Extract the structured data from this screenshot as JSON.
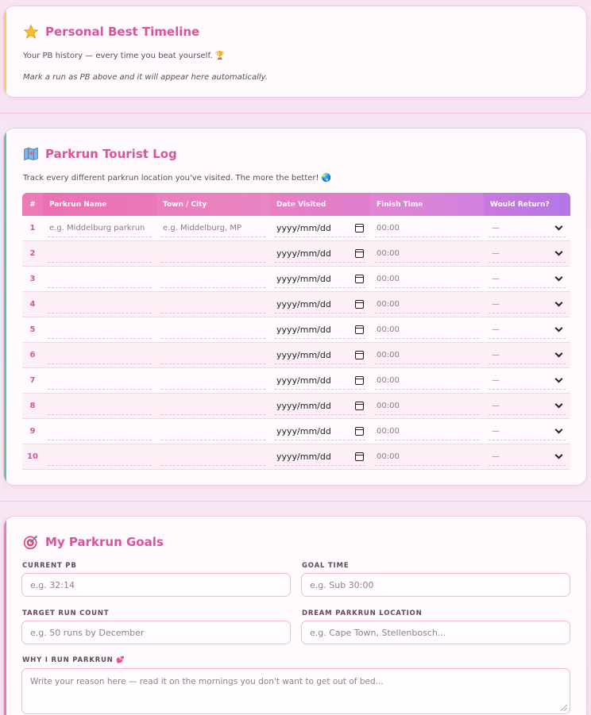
{
  "pb_timeline": {
    "title": "Personal Best Timeline",
    "icon": "star-icon",
    "description": "Your PB history — every time you beat yourself. 🏆",
    "empty_message": "Mark a run as PB above and it will appear here automatically."
  },
  "tourist_log": {
    "title": "Parkrun Tourist Log",
    "icon": "map-icon",
    "description": "Track every different parkrun location you've visited. The more the better! 🌏",
    "columns": [
      "#",
      "Parkrun Name",
      "Town / City",
      "Date Visited",
      "Finish Time",
      "Would Return?"
    ],
    "rows": [
      {
        "num": "1",
        "name_placeholder": "e.g. Middelburg parkrun",
        "town_placeholder": "e.g. Middelburg, MP",
        "date": "yyyy/mm/dd",
        "time": "00:00",
        "return": "—"
      },
      {
        "num": "2",
        "name_placeholder": "",
        "town_placeholder": "",
        "date": "yyyy/mm/dd",
        "time": "00:00",
        "return": "—"
      },
      {
        "num": "3",
        "name_placeholder": "",
        "town_placeholder": "",
        "date": "yyyy/mm/dd",
        "time": "00:00",
        "return": "—"
      },
      {
        "num": "4",
        "name_placeholder": "",
        "town_placeholder": "",
        "date": "yyyy/mm/dd",
        "time": "00:00",
        "return": "—"
      },
      {
        "num": "5",
        "name_placeholder": "",
        "town_placeholder": "",
        "date": "yyyy/mm/dd",
        "time": "00:00",
        "return": "—"
      },
      {
        "num": "6",
        "name_placeholder": "",
        "town_placeholder": "",
        "date": "yyyy/mm/dd",
        "time": "00:00",
        "return": "—"
      },
      {
        "num": "7",
        "name_placeholder": "",
        "town_placeholder": "",
        "date": "yyyy/mm/dd",
        "time": "00:00",
        "return": "—"
      },
      {
        "num": "8",
        "name_placeholder": "",
        "town_placeholder": "",
        "date": "yyyy/mm/dd",
        "time": "00:00",
        "return": "—"
      },
      {
        "num": "9",
        "name_placeholder": "",
        "town_placeholder": "",
        "date": "yyyy/mm/dd",
        "time": "00:00",
        "return": "—"
      },
      {
        "num": "10",
        "name_placeholder": "",
        "town_placeholder": "",
        "date": "yyyy/mm/dd",
        "time": "00:00",
        "return": "—"
      }
    ]
  },
  "goals": {
    "title": "My Parkrun Goals",
    "icon": "target-icon",
    "current_pb_label": "CURRENT PB",
    "current_pb_placeholder": "e.g. 32:14",
    "goal_time_label": "GOAL TIME",
    "goal_time_placeholder": "e.g. Sub 30:00",
    "target_count_label": "TARGET RUN COUNT",
    "target_count_placeholder": "e.g. 50 runs by December",
    "dream_location_label": "DREAM PARKRUN LOCATION",
    "dream_location_placeholder": "e.g. Cape Town, Stellenbosch...",
    "why_label": "WHY I RUN PARKRUN 💕",
    "why_placeholder": "Write your reason here — read it on the mornings you don't want to get out of bed..."
  },
  "colors": {
    "accent": "#d9559a",
    "header_gradient_start": "#ec6fb0",
    "header_gradient_end": "#b476e8",
    "pb_stripe": "#f3cf6a",
    "tourist_stripe": "#5cc99a",
    "goals_stripe": "#f07ab5"
  }
}
